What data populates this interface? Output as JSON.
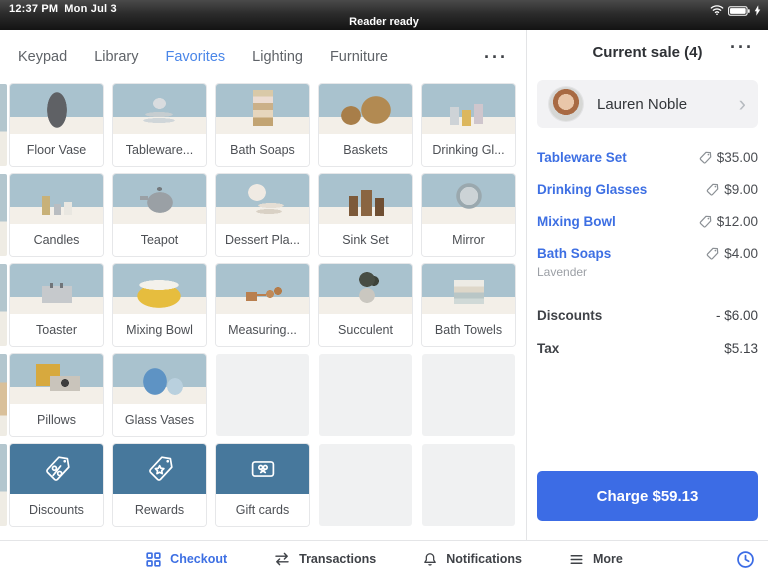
{
  "status_bar": {
    "time": "12:37 PM",
    "date": "Mon Jul 3",
    "reader_status": "Reader ready"
  },
  "tabs": [
    {
      "label": "Keypad",
      "active": false
    },
    {
      "label": "Library",
      "active": false
    },
    {
      "label": "Favorites",
      "active": true
    },
    {
      "label": "Lighting",
      "active": false
    },
    {
      "label": "Furniture",
      "active": false
    }
  ],
  "tabs_more_glyph": "···",
  "grid": {
    "tiles": [
      {
        "kind": "product",
        "label": "Floor Vase",
        "image": "floor-vase"
      },
      {
        "kind": "product",
        "label": "Tableware...",
        "image": "tableware"
      },
      {
        "kind": "product",
        "label": "Bath Soaps",
        "image": "bath-soaps"
      },
      {
        "kind": "product",
        "label": "Baskets",
        "image": "baskets"
      },
      {
        "kind": "product",
        "label": "Drinking Gl...",
        "image": "drinking-glasses"
      },
      {
        "kind": "product",
        "label": "Candles",
        "image": "candles"
      },
      {
        "kind": "product",
        "label": "Teapot",
        "image": "teapot"
      },
      {
        "kind": "product",
        "label": "Dessert Pla...",
        "image": "dessert-plates"
      },
      {
        "kind": "product",
        "label": "Sink Set",
        "image": "sink-set"
      },
      {
        "kind": "product",
        "label": "Mirror",
        "image": "mirror"
      },
      {
        "kind": "product",
        "label": "Toaster",
        "image": "toaster"
      },
      {
        "kind": "product",
        "label": "Mixing Bowl",
        "image": "mixing-bowl"
      },
      {
        "kind": "product",
        "label": "Measuring...",
        "image": "measuring"
      },
      {
        "kind": "product",
        "label": "Succulent",
        "image": "succulent"
      },
      {
        "kind": "product",
        "label": "Bath Towels",
        "image": "bath-towels"
      },
      {
        "kind": "product",
        "label": "Pillows",
        "image": "pillows"
      },
      {
        "kind": "product",
        "label": "Glass Vases",
        "image": "glass-vases"
      },
      {
        "kind": "empty"
      },
      {
        "kind": "empty"
      },
      {
        "kind": "empty"
      },
      {
        "kind": "action",
        "label": "Discounts",
        "icon": "discount-tag-icon"
      },
      {
        "kind": "action",
        "label": "Rewards",
        "icon": "reward-tag-icon"
      },
      {
        "kind": "action",
        "label": "Gift cards",
        "icon": "gift-card-icon"
      },
      {
        "kind": "empty"
      },
      {
        "kind": "empty"
      }
    ]
  },
  "sale": {
    "title": "Current sale (4)",
    "menu_glyph": "···",
    "customer": {
      "name": "Lauren Noble",
      "chevron_glyph": "›"
    },
    "items": [
      {
        "name": "Tableware Set",
        "price": "$35.00"
      },
      {
        "name": "Drinking Glasses",
        "price": "$9.00"
      },
      {
        "name": "Mixing Bowl",
        "price": "$12.00"
      },
      {
        "name": "Bath Soaps",
        "note": "Lavender",
        "price": "$4.00"
      }
    ],
    "adjustments": [
      {
        "label": "Discounts",
        "value": "- $6.00"
      },
      {
        "label": "Tax",
        "value": "$5.13"
      }
    ],
    "charge_label": "Charge $59.13"
  },
  "bottom_nav": {
    "items": [
      {
        "label": "Checkout",
        "icon": "checkout-grid",
        "active": true
      },
      {
        "label": "Transactions",
        "icon": "transfer-arrows",
        "active": false
      },
      {
        "label": "Notifications",
        "icon": "bell",
        "active": false
      },
      {
        "label": "More",
        "icon": "menu",
        "active": false
      }
    ]
  },
  "colors": {
    "accent_blue": "#3c6ce5",
    "tab_active_blue": "#4a86e8",
    "action_tile_blue": "#47789c",
    "backdrop_blue": "#a9c2ce",
    "status_bar_dark": "#1c1c1c"
  }
}
